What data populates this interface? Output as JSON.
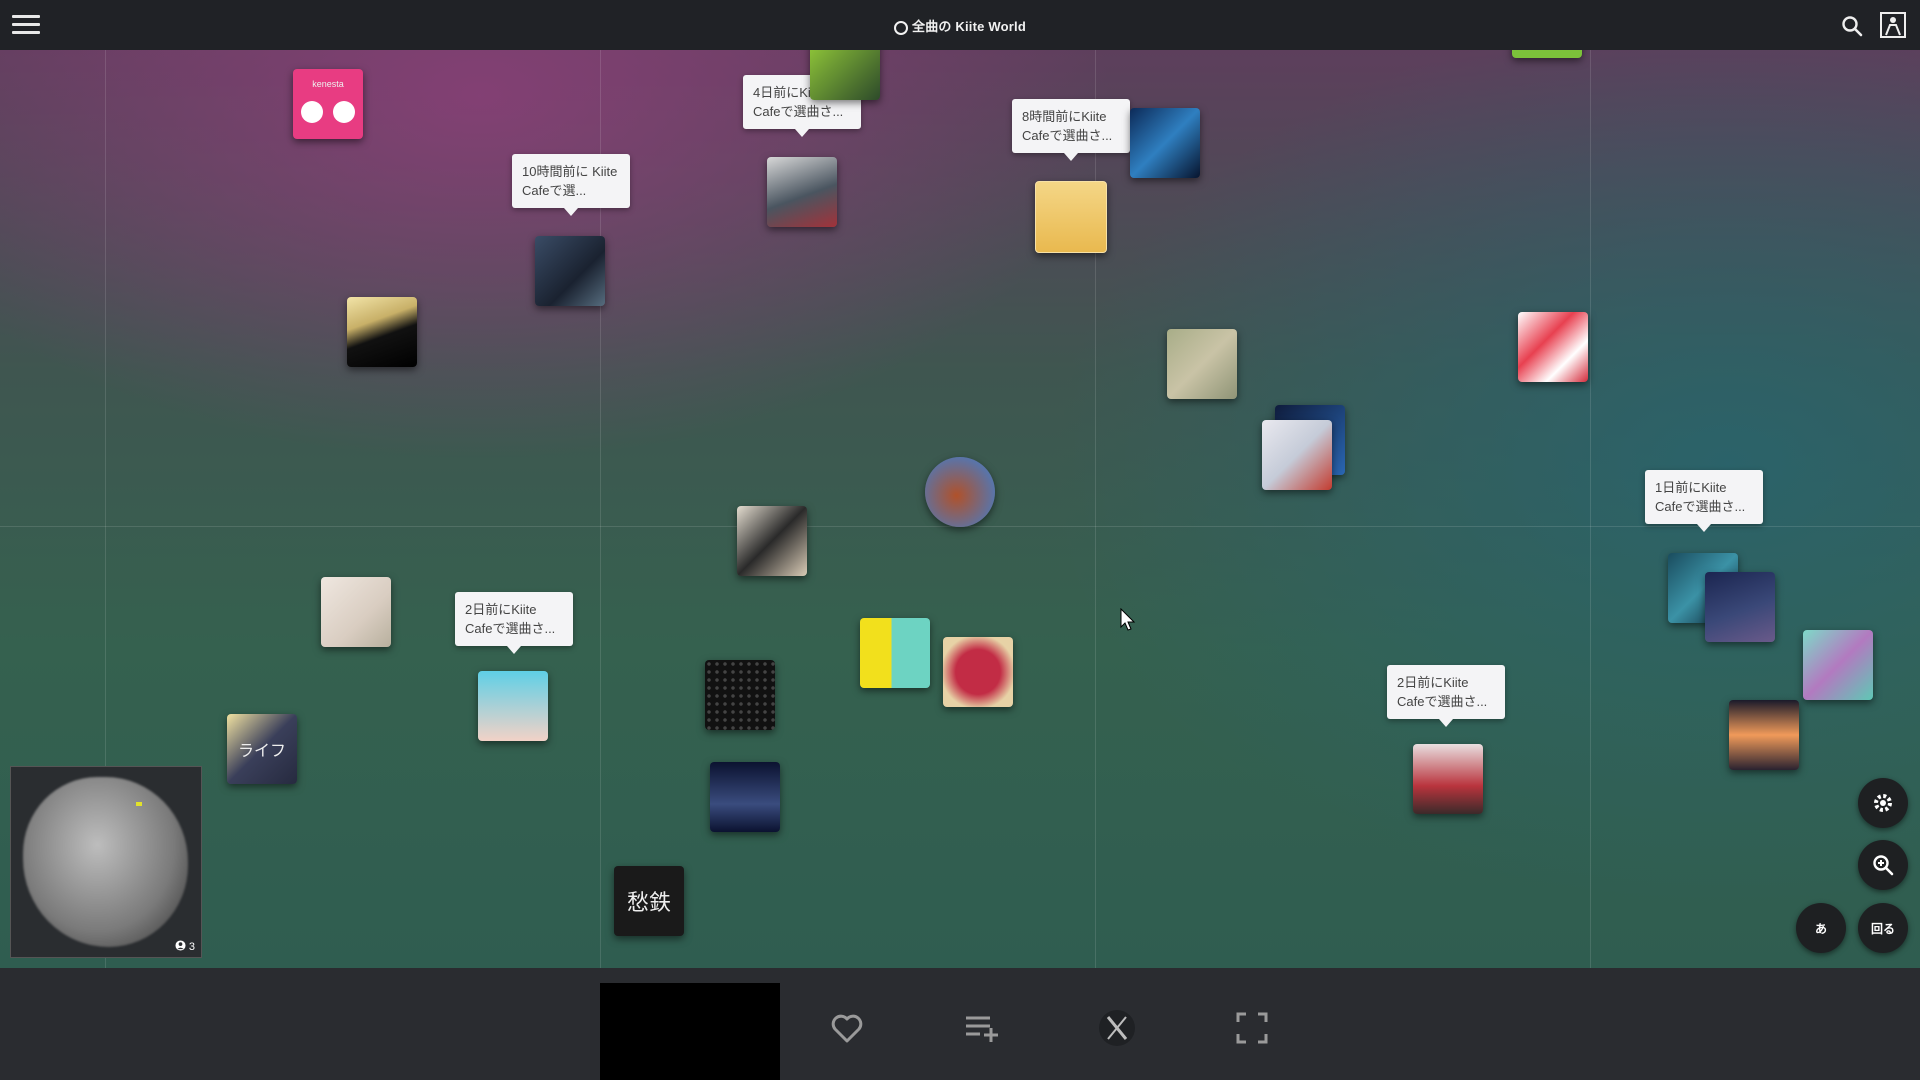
{
  "header": {
    "title": "全曲の Kiite World",
    "menu_icon": "hamburger-menu-icon",
    "search_icon": "search-icon",
    "user_icon": "user-profile-icon"
  },
  "bubbles": [
    {
      "text": "4日前にKiite Cafeで選曲さ..."
    },
    {
      "text": "8時間前にKiite Cafeで選曲さ..."
    },
    {
      "text": "10時間前に Kiite Cafeで選..."
    },
    {
      "text": "1日前にKiite Cafeで選曲さ..."
    },
    {
      "text": "2日前にKiite Cafeで選曲さ..."
    },
    {
      "text": "2日前にKiite Cafeで選曲さ..."
    }
  ],
  "tiles": [
    {
      "label": "kenesta",
      "color": "#e83c82"
    },
    {
      "label": "ライフ",
      "color": "#3a3f5a"
    },
    {
      "label": "愁鉄",
      "color": "#1a1a1a"
    }
  ],
  "minimap": {
    "users_count": "3",
    "users_icon": "user-count-icon"
  },
  "controls": {
    "settings_icon": "gear-icon",
    "zoom_icon": "zoom-in-icon",
    "kana_button": "あ",
    "rotate_button": "回る"
  },
  "bottom": {
    "favorite_icon": "heart-icon",
    "playlist_add_icon": "playlist-add-icon",
    "x_share_icon": "x-logo-icon",
    "fullscreen_icon": "fullscreen-icon"
  }
}
